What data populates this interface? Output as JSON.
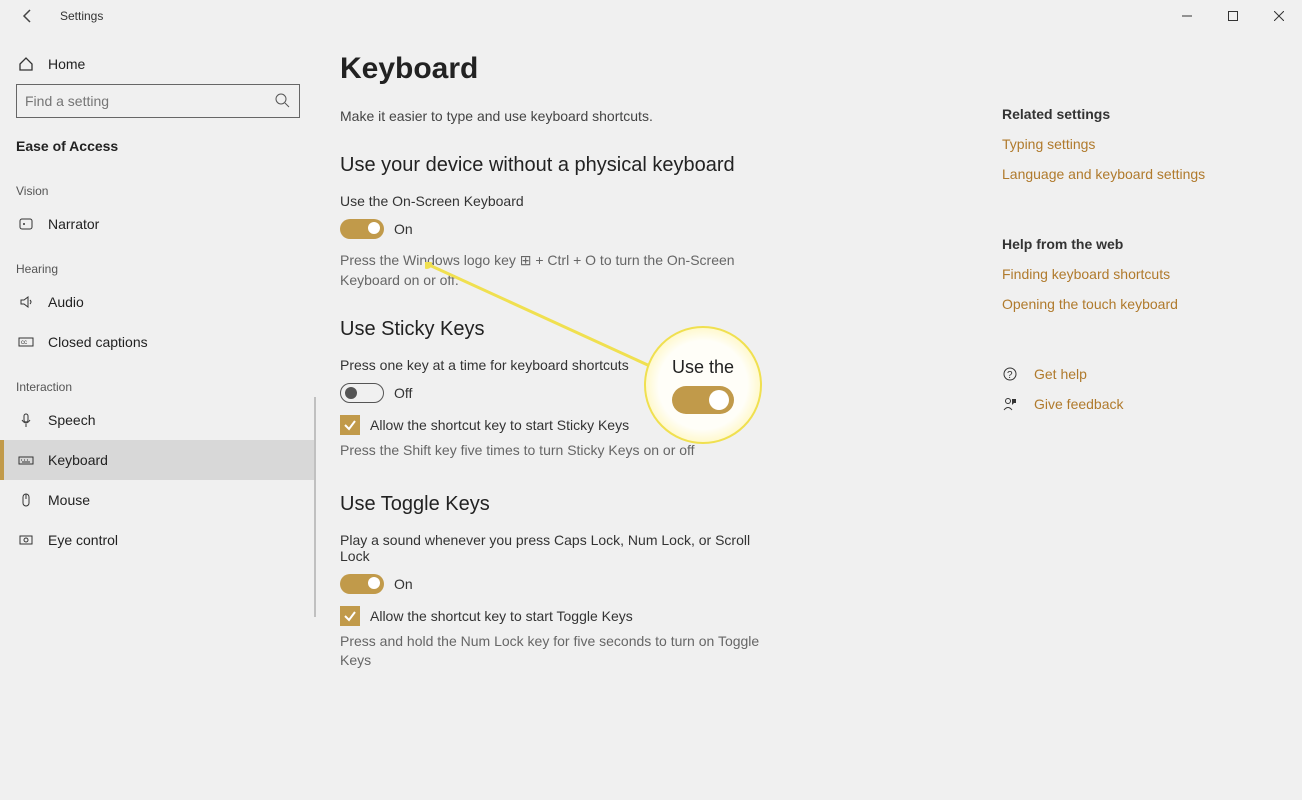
{
  "window": {
    "title": "Settings"
  },
  "sidebar": {
    "home": "Home",
    "search_placeholder": "Find a setting",
    "category": "Ease of Access",
    "sections": {
      "vision": "Vision",
      "hearing": "Hearing",
      "interaction": "Interaction"
    },
    "items": {
      "narrator": "Narrator",
      "audio": "Audio",
      "closed_captions": "Closed captions",
      "speech": "Speech",
      "keyboard": "Keyboard",
      "mouse": "Mouse",
      "eye_control": "Eye control"
    }
  },
  "page": {
    "title": "Keyboard",
    "intro": "Make it easier to type and use keyboard shortcuts.",
    "osk": {
      "heading": "Use your device without a physical keyboard",
      "label": "Use the On-Screen Keyboard",
      "state": "On",
      "hint": "Press the Windows logo key ⊞ + Ctrl + O to turn the On-Screen Keyboard on or off."
    },
    "sticky": {
      "heading": "Use Sticky Keys",
      "label": "Press one key at a time for keyboard shortcuts",
      "state": "Off",
      "check_label": "Allow the shortcut key to start Sticky Keys",
      "check_hint": "Press the Shift key five times to turn Sticky Keys on or off"
    },
    "toggle_keys": {
      "heading": "Use Toggle Keys",
      "label": "Play a sound whenever you press Caps Lock, Num Lock, or Scroll Lock",
      "state": "On",
      "check_label": "Allow the shortcut key to start Toggle Keys",
      "check_hint": "Press and hold the Num Lock key for five seconds to turn on Toggle Keys"
    }
  },
  "right": {
    "related_heading": "Related settings",
    "related": {
      "typing": "Typing settings",
      "language": "Language and keyboard settings"
    },
    "web_heading": "Help from the web",
    "web": {
      "shortcuts": "Finding keyboard shortcuts",
      "touch": "Opening the touch keyboard"
    },
    "help": "Get help",
    "feedback": "Give feedback"
  },
  "callout": {
    "text": "Use the"
  }
}
